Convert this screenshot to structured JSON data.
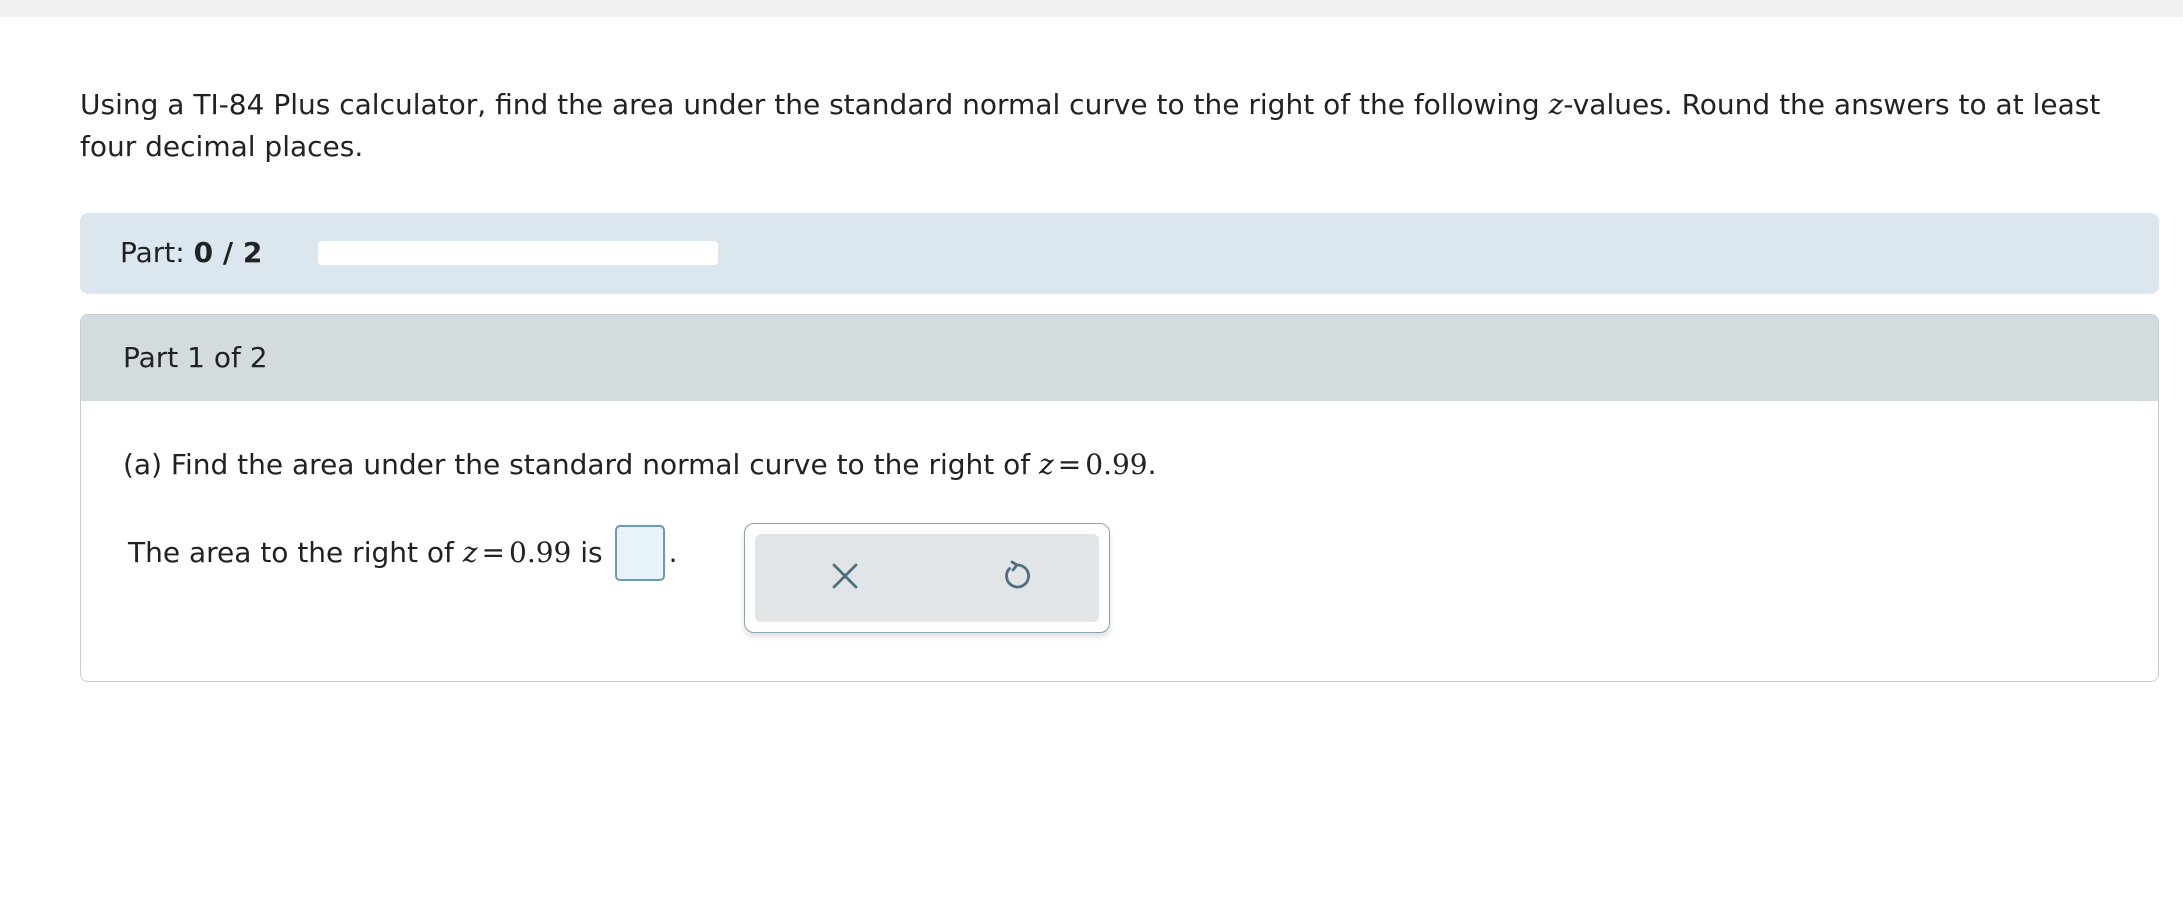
{
  "intro": {
    "text_before": "Using a TI-84 Plus calculator, find the area under the standard normal curve to the right of the following ",
    "var": "z",
    "text_after": "-values. Round the answers to at least four decimal places."
  },
  "progress": {
    "label": "Part:",
    "value": "0 / 2",
    "fraction": 0
  },
  "part": {
    "header": "Part 1 of 2",
    "question_prefix": "(a) Find the area under the standard normal curve to the right of ",
    "z_var": "z",
    "equals": "=",
    "z_value": "0.99",
    "question_suffix": ".",
    "answer_prefix": "The area to the right of ",
    "answer_mid": " is",
    "answer_suffix": "."
  },
  "tools": {
    "clear_icon": "x-icon",
    "undo_icon": "undo-icon"
  },
  "colors": {
    "progress_bg": "#dce6ef",
    "header_bg": "#d4dbdf",
    "icon": "#4f6e80"
  }
}
